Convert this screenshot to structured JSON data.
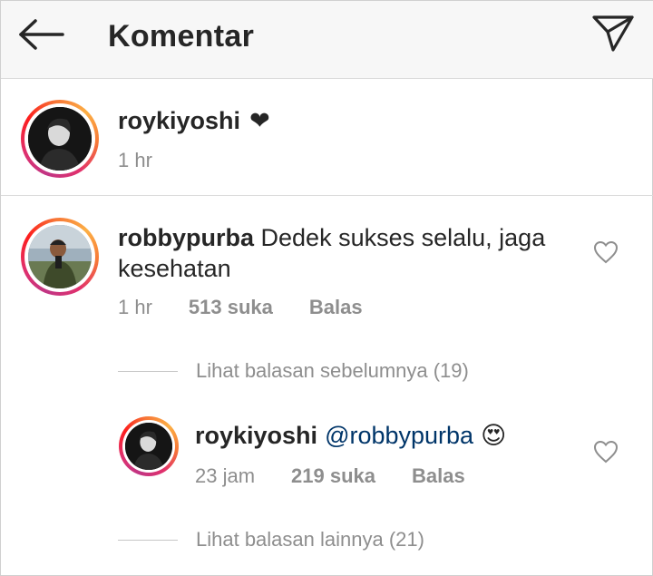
{
  "header": {
    "title": "Komentar",
    "back_icon": "arrow-left-icon",
    "send_icon": "paper-plane-icon"
  },
  "caption": {
    "username": "roykiyoshi",
    "text": "❤",
    "time": "1 hr"
  },
  "comment": {
    "username": "robbypurba",
    "text_line1": "Dedek sukses selalu, jaga",
    "text_line2": "kesehatan",
    "time": "1 hr",
    "likes": "513 suka",
    "reply_label": "Balas",
    "view_previous": "Lihat balasan sebelumnya (19)"
  },
  "reply": {
    "username": "roykiyoshi",
    "mention": "@robbypurba",
    "emoji": "😍",
    "time": "23 jam",
    "likes": "219 suka",
    "reply_label": "Balas",
    "view_more": "Lihat balasan lainnya (21)"
  },
  "colors": {
    "text": "#262626",
    "muted": "#8e8e8e",
    "mention": "#003569",
    "header_bg": "#f7f7f7",
    "divider": "#dbdbdb"
  }
}
